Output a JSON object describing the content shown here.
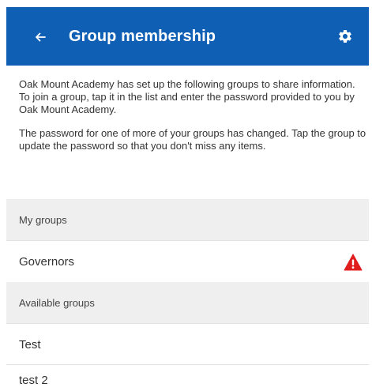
{
  "header": {
    "title": "Group membership",
    "back_icon": "arrow-left-icon",
    "settings_icon": "gear-icon"
  },
  "intro": {
    "paragraph1": "Oak Mount Academy has set up the following groups to share information. To join a group, tap it in the list and enter the password provided to you by Oak Mount Academy.",
    "paragraph2": "The password for one of more of your groups has changed. Tap the group to update the password so that you don't miss any items."
  },
  "my_groups": {
    "header": "My groups",
    "items": [
      {
        "name": "Governors",
        "status_icon": "warning-triangle-icon"
      }
    ]
  },
  "available_groups": {
    "header": "Available groups",
    "items": [
      {
        "name": "Test"
      },
      {
        "name": "test 2"
      }
    ]
  },
  "colors": {
    "app_bar": "#0f5fb5",
    "warning": "#e01e1e",
    "section_bg": "#efefef"
  }
}
